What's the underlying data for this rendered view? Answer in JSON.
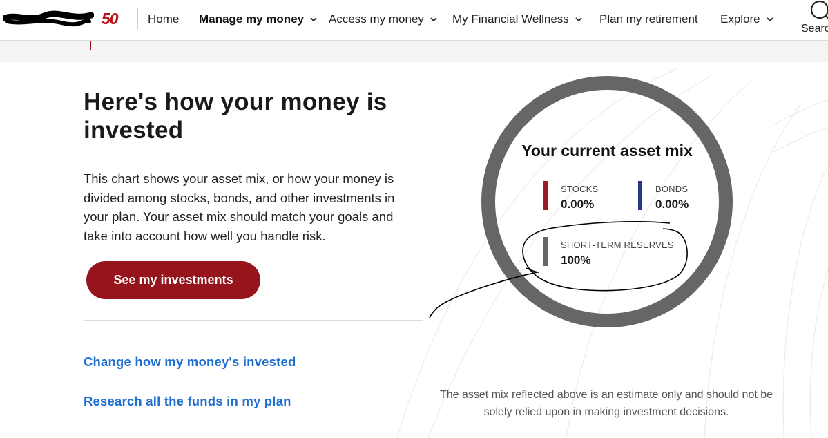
{
  "header": {
    "badge_text": "50",
    "nav": [
      {
        "label": "Home"
      },
      {
        "label": "Manage my money"
      },
      {
        "label": "Access my money"
      },
      {
        "label": "My Financial Wellness"
      },
      {
        "label": "Plan my retirement"
      },
      {
        "label": "Explore"
      }
    ],
    "search_label": "Searc"
  },
  "main": {
    "headline": "Here's how your money is invested",
    "intro": "This chart shows your asset mix, or how your money is divided among stocks, bonds, and other investments in your plan. Your asset mix should match your goals and take into account how well you handle risk.",
    "cta_label": "See my investments",
    "links": [
      {
        "label": "Change how my money's invested"
      },
      {
        "label": "Research all the funds in my plan"
      }
    ]
  },
  "asset_mix": {
    "title": "Your current asset mix",
    "items": [
      {
        "name": "STOCKS",
        "value": "0.00%",
        "percent": 0,
        "color": "#9b1b22"
      },
      {
        "name": "BONDS",
        "value": "0.00%",
        "percent": 0,
        "color": "#233a8a"
      },
      {
        "name": "SHORT-TERM RESERVES",
        "value": "100%",
        "percent": 100,
        "color": "#666666"
      }
    ],
    "disclaimer": "The asset mix reflected above is an estimate only and should not be solely relied upon in making investment decisions."
  },
  "colors": {
    "brand_red": "#96151d",
    "link_blue": "#1f6fd1",
    "donut_gray": "#666666"
  }
}
